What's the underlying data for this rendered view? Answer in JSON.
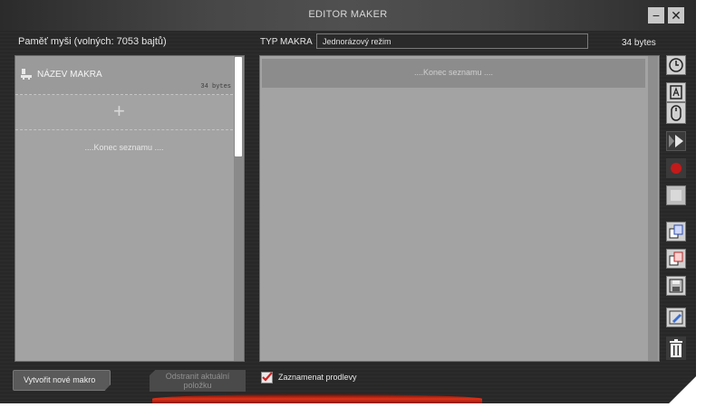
{
  "window": {
    "title": "EDITOR MAKER",
    "minimize_label": "−",
    "close_label": "✕"
  },
  "memory": {
    "label": "Paměť myši (volných: 7053 bajtů)"
  },
  "macro_type": {
    "label": "TYP MAKRA",
    "value": "Jednorázový režim"
  },
  "size": {
    "label": "34 bytes"
  },
  "macro_list": {
    "items": [
      {
        "name": "NÁZEV MAKRA",
        "bytes": "34 bytes"
      }
    ],
    "add_symbol": "+",
    "end_text": "....Konec seznamu ...."
  },
  "event_list": {
    "end_text": "....Konec seznamu ...."
  },
  "toolbar": {
    "icons": [
      "clock-icon",
      "keyboard-icon",
      "mouse-icon",
      "play-icon",
      "record-icon",
      "stop-icon",
      "copy-icon",
      "paste-icon",
      "save-icon",
      "edit-icon",
      "trash-icon"
    ],
    "record_color": "#c41a1a"
  },
  "footer": {
    "create_label": "Vytvořit nové makro",
    "remove_label_line1": "Odstranit aktuální",
    "remove_label_line2": "položku",
    "delays_label": "Zaznamenat prodlevy",
    "delays_checked": true
  },
  "colors": {
    "accent": "#e0321a",
    "panel": "#a3a3a3"
  }
}
